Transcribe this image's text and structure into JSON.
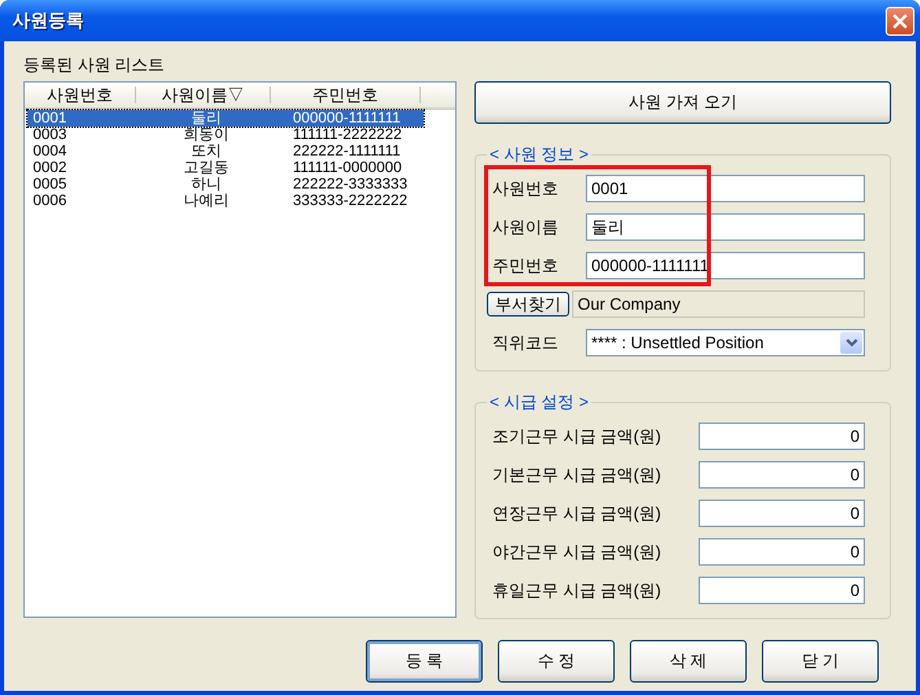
{
  "window": {
    "title": "사원등록"
  },
  "employee_list": {
    "label": "등록된 사원 리스트",
    "columns": [
      "사원번호",
      "사원이름▽",
      "주민번호"
    ],
    "rows": [
      {
        "cells": [
          "0001",
          "둘리",
          "000000-1111111"
        ],
        "selected": true
      },
      {
        "cells": [
          "0003",
          "희동이",
          "111111-2222222"
        ],
        "selected": false
      },
      {
        "cells": [
          "0004",
          "또치",
          "222222-1111111"
        ],
        "selected": false
      },
      {
        "cells": [
          "0002",
          "고길동",
          "111111-0000000"
        ],
        "selected": false
      },
      {
        "cells": [
          "0005",
          "하니",
          "222222-3333333"
        ],
        "selected": false
      },
      {
        "cells": [
          "0006",
          "나예리",
          "333333-2222222"
        ],
        "selected": false
      }
    ]
  },
  "load_button": "사원 가져 오기",
  "employee_info": {
    "title": "< 사원 정보 >",
    "fields": [
      {
        "label": "사원번호",
        "value": "0001"
      },
      {
        "label": "사원이름",
        "value": "둘리"
      },
      {
        "label": "주민번호",
        "value": "000000-1111111"
      }
    ],
    "department": {
      "button": "부서찾기",
      "value": "Our Company"
    },
    "position": {
      "label": "직위코드",
      "value": "**** : Unsettled Position"
    }
  },
  "wage_settings": {
    "title": "< 시급 설정 >",
    "fields": [
      {
        "label": "조기근무 시급 금액(원)",
        "value": "0"
      },
      {
        "label": "기본근무 시급 금액(원)",
        "value": "0"
      },
      {
        "label": "연장근무 시급 금액(원)",
        "value": "0"
      },
      {
        "label": "야간근무 시급 금액(원)",
        "value": "0"
      },
      {
        "label": "휴일근무 시급 금액(원)",
        "value": "0"
      }
    ]
  },
  "buttons": [
    {
      "label": "등 록",
      "default": true
    },
    {
      "label": "수 정",
      "default": false
    },
    {
      "label": "삭 제",
      "default": false
    },
    {
      "label": "닫 기",
      "default": false
    }
  ]
}
